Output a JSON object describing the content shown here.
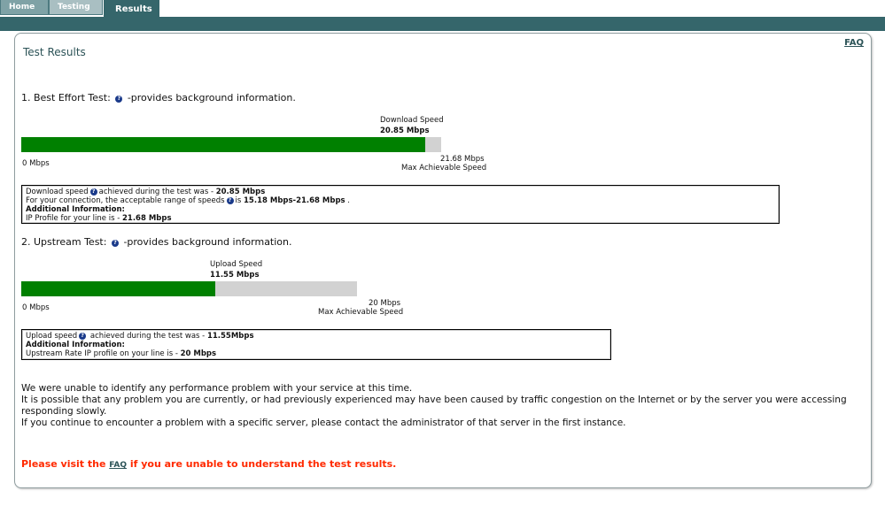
{
  "tabs": [
    {
      "label": "Home"
    },
    {
      "label": "Testing"
    },
    {
      "label": "Results"
    }
  ],
  "faq_link": "FAQ",
  "title": "Test Results",
  "best_effort": {
    "heading_pre": "1. Best Effort Test:",
    "heading_post": "-provides background information.",
    "speed_caption": "Download Speed",
    "speed_value": "20.85 Mbps",
    "min_label": "0 Mbps",
    "max_value": "21.68 Mbps",
    "max_caption": "Max Achievable Speed",
    "fill_fraction": 0.9617,
    "info": {
      "line1_pre": "Download speed",
      "line1_mid": "achieved during the test was - ",
      "line1_val": "20.85 Mbps",
      "line2_pre": "For your connection, the acceptable range of speeds",
      "line2_mid": "is ",
      "line2_val": "15.18 Mbps-21.68 Mbps",
      "line2_end": " .",
      "line3": "Additional Information:",
      "line4_pre": "IP Profile for your line is - ",
      "line4_val": "21.68 Mbps"
    }
  },
  "upstream": {
    "heading_pre": "2. Upstream Test:",
    "heading_post": "-provides background information.",
    "speed_caption": "Upload Speed",
    "speed_value": "11.55 Mbps",
    "min_label": "0 Mbps",
    "max_value": "20 Mbps",
    "max_caption": "Max Achievable Speed",
    "fill_fraction": 0.5775,
    "info": {
      "line1_pre": "Upload speed",
      "line1_mid": " achieved during the test was - ",
      "line1_val": "11.55Mbps",
      "line2": "Additional Information:",
      "line3_pre": "Upstream Rate IP profile on your line is - ",
      "line3_val": "20 Mbps"
    }
  },
  "summary": {
    "line1": "We were unable to identify any performance problem with your service at this time.",
    "line2": "It is possible that any problem you are currently, or had previously experienced may have been caused by traffic congestion on the Internet or by the server you were accessing responding slowly.",
    "line3": "If you continue to encounter a problem with a specific server, please contact the administrator of that server in the first instance."
  },
  "notice": {
    "pre": "Please visit the ",
    "link": "FAQ",
    "post": " if you are unable to understand the test results."
  },
  "colors": {
    "accent": "#35666b",
    "bar_fill": "#008000",
    "bar_track": "#d2d2d2",
    "notice": "#ff2a00"
  },
  "icons": {
    "help": "question-circle-icon"
  }
}
